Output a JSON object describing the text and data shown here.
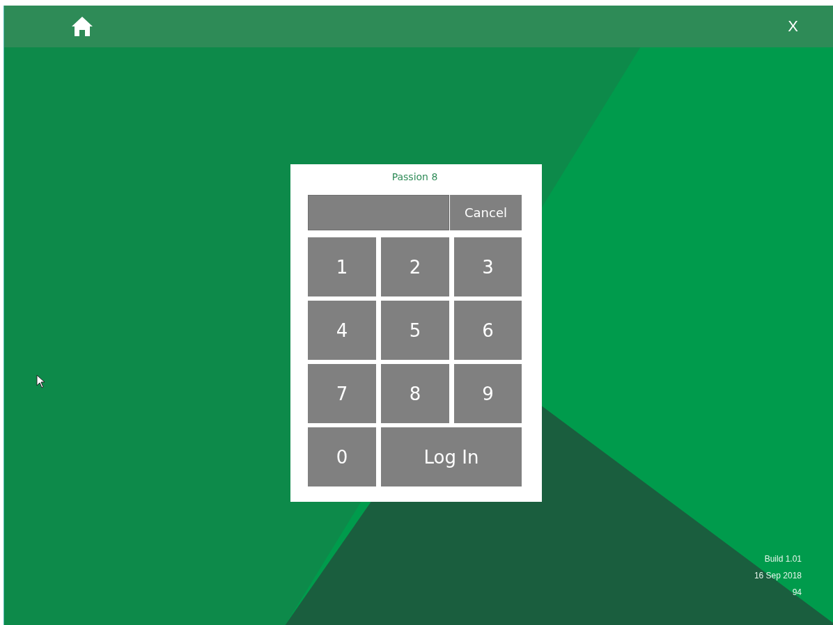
{
  "header": {
    "close_label": "X"
  },
  "dialog": {
    "title": "Passion 8",
    "cancel_label": "Cancel",
    "keys": [
      {
        "label": "1",
        "kind": "digit"
      },
      {
        "label": "2",
        "kind": "digit"
      },
      {
        "label": "3",
        "kind": "digit"
      },
      {
        "label": "4",
        "kind": "digit"
      },
      {
        "label": "5",
        "kind": "digit"
      },
      {
        "label": "6",
        "kind": "digit"
      },
      {
        "label": "7",
        "kind": "digit"
      },
      {
        "label": "8",
        "kind": "digit"
      },
      {
        "label": "9",
        "kind": "digit"
      },
      {
        "label": "0",
        "kind": "digit"
      },
      {
        "label": "Log In",
        "kind": "submit"
      }
    ]
  },
  "build_info": [
    "Build 1.01",
    "16 Sep 2018",
    "94"
  ]
}
